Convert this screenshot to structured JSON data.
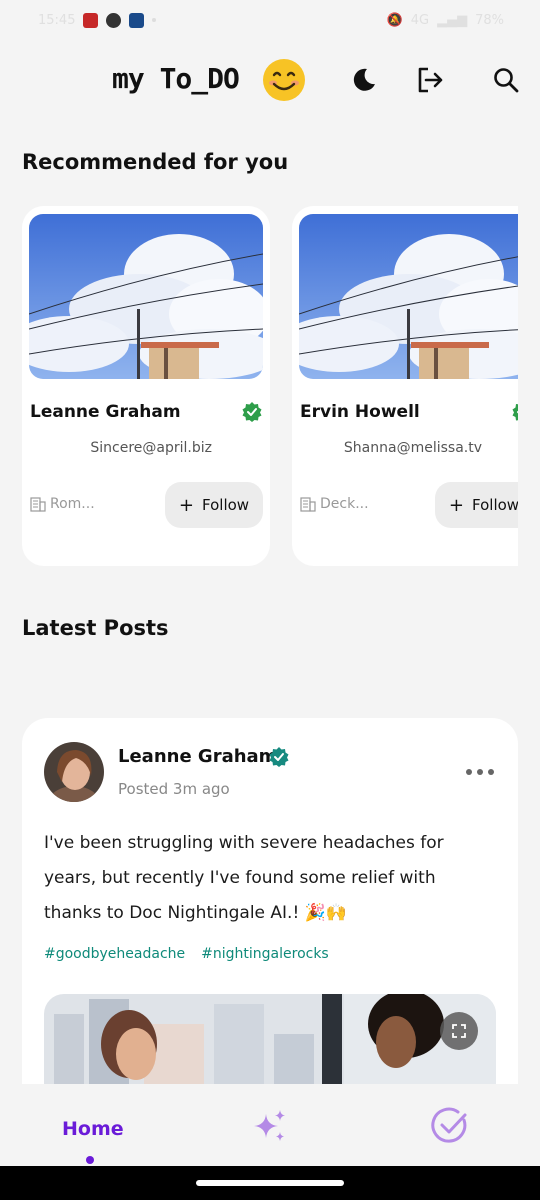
{
  "status_bar": {
    "time": "15:45",
    "network": "4G",
    "battery": "78%"
  },
  "header": {
    "title": "my To_DO",
    "emoji": "😊",
    "icons": [
      "moon-icon",
      "logout-icon",
      "search-icon"
    ]
  },
  "recommended": {
    "title": "Recommended for you",
    "cards": [
      {
        "name": "Leanne Graham",
        "email": "Sincere@april.biz",
        "company": "Rom...",
        "follow_label": "Follow"
      },
      {
        "name": "Ervin Howell",
        "email": "Shanna@melissa.tv",
        "company": "Deck...",
        "follow_label": "Follow"
      }
    ]
  },
  "latest_posts": {
    "title": "Latest Posts",
    "post": {
      "author": "Leanne Graham",
      "time": "Posted 3m ago",
      "text_line1": "I've been struggling with severe headaches for",
      "text_line2": "years, but recently I've found some relief with",
      "text_line3": "thanks to Doc Nightingale AI.! 🎉🙌",
      "tags": [
        "#goodbyeheadache",
        "#nightingalerocks"
      ]
    }
  },
  "bottom_nav": {
    "home_label": "Home",
    "icons": [
      "sparkles-icon",
      "check-circle-icon"
    ]
  },
  "colors": {
    "accent": "#6a1bd8",
    "tag": "#0f8a7a",
    "verified": "#2e9e4a",
    "background": "#f4f4f4"
  }
}
